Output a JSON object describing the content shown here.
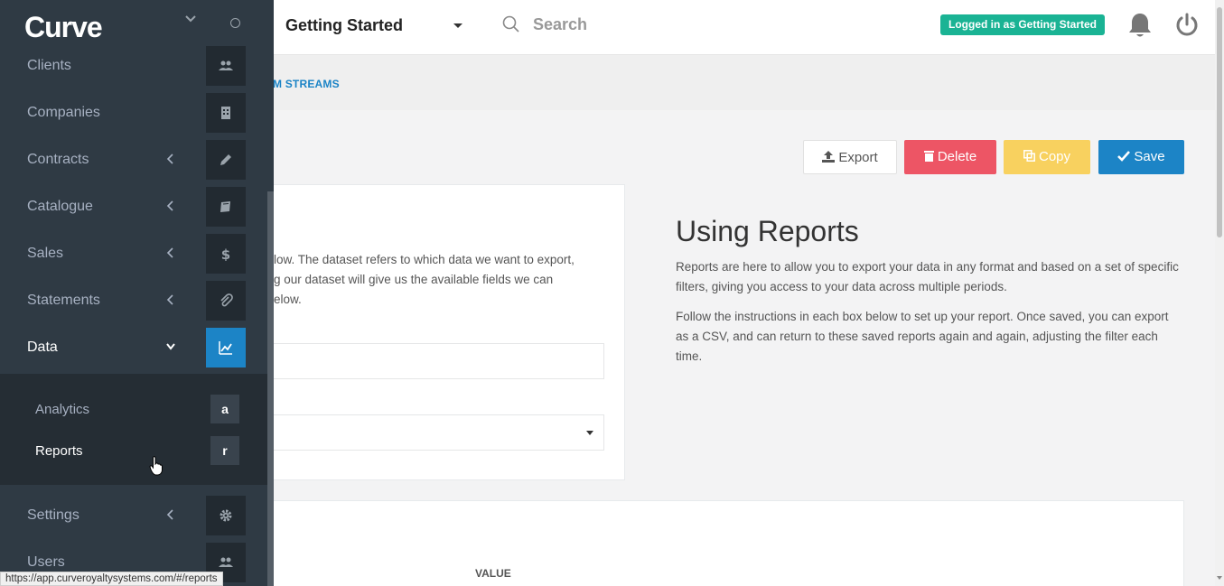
{
  "brand": {
    "logo": "Curve"
  },
  "header": {
    "workspace_title": "Getting Started",
    "search_placeholder": "Search",
    "login_badge": "Logged in as Getting Started"
  },
  "breadcrumb": {
    "link": "M STREAMS"
  },
  "actions": {
    "export": "Export",
    "delete": "Delete",
    "copy": "Copy",
    "save": "Save"
  },
  "left_box": {
    "text_lines": [
      "low. The dataset refers to which data we want to export,",
      "g our dataset will give us the available fields we can",
      "elow."
    ]
  },
  "info": {
    "title": "Using Reports",
    "p1": "Reports are here to allow you to export your data in any format and based on a set of specific filters, giving you access to your data across multiple periods.",
    "p2": "Follow the instructions in each box below to set up your report. Once saved, you can export as a CSV, and can return to these saved reports again and again, adjusting the filter each time."
  },
  "table": {
    "value_header": "VALUE"
  },
  "sidebar": {
    "items": [
      {
        "label": "Clients",
        "icon": "users-icon"
      },
      {
        "label": "Companies",
        "icon": "building-icon"
      },
      {
        "label": "Contracts",
        "icon": "pencil-icon"
      },
      {
        "label": "Catalogue",
        "icon": "book-icon"
      },
      {
        "label": "Sales",
        "icon": "dollar-icon"
      },
      {
        "label": "Statements",
        "icon": "paperclip-icon"
      },
      {
        "label": "Data",
        "icon": "line-chart-icon"
      },
      {
        "label": "Settings",
        "icon": "gear-icon"
      },
      {
        "label": "Users",
        "icon": "users-icon"
      }
    ],
    "submenu": [
      {
        "label": "Analytics",
        "letter": "a"
      },
      {
        "label": "Reports",
        "letter": "r"
      }
    ]
  },
  "status_bar": {
    "url": "https://app.curveroyaltysystems.com/#/reports"
  },
  "colors": {
    "sidebar": "#2f3a44",
    "accent_blue": "#1c84c6",
    "badge_green": "#1ab394",
    "delete_red": "#ed5565",
    "copy_yellow": "#f8d15f"
  }
}
